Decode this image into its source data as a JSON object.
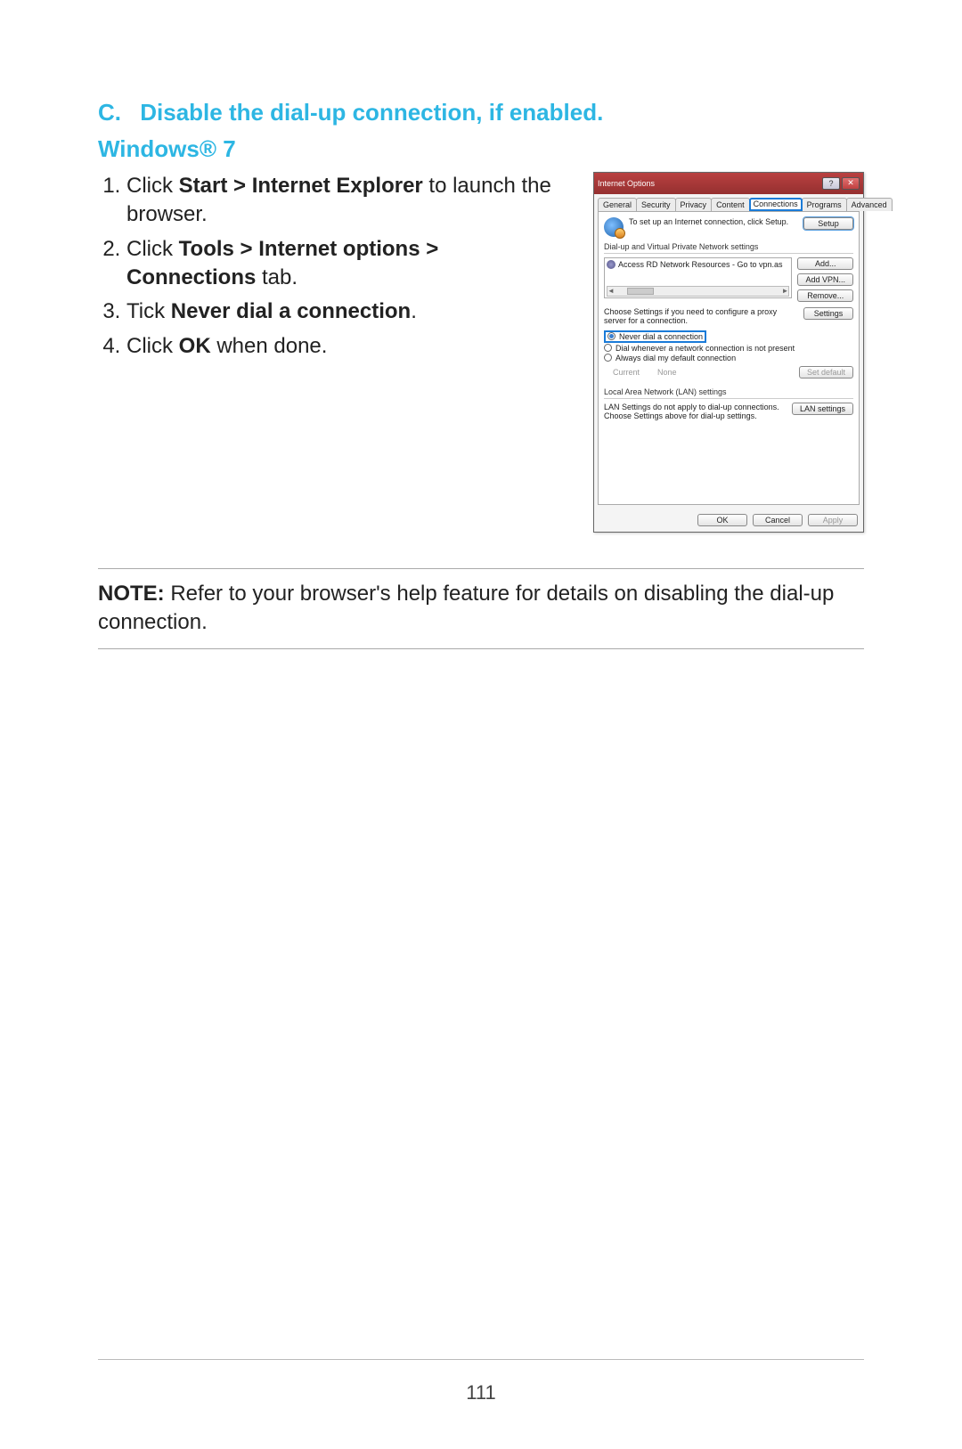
{
  "section": {
    "prefix": "C.",
    "title": "Disable the dial-up connection, if enabled.",
    "os": "Windows® 7"
  },
  "steps": {
    "s1a": "Click ",
    "s1b": "Start > Internet Explorer",
    "s1c": " to launch the browser.",
    "s2a": "Click ",
    "s2b": "Tools > Internet options > Connections",
    "s2c": " tab.",
    "s3a": "Tick ",
    "s3b": "Never dial a connection",
    "s3c": ".",
    "s4a": "Click ",
    "s4b": "OK",
    "s4c": " when done."
  },
  "note": {
    "label": "NOTE:",
    "text": " Refer to your browser's help feature for details on disabling the dial-up connection."
  },
  "dialog": {
    "title": "Internet Options",
    "tabs": {
      "general": "General",
      "security": "Security",
      "privacy": "Privacy",
      "content": "Content",
      "connections": "Connections",
      "programs": "Programs",
      "advanced": "Advanced"
    },
    "setup_text": "To set up an Internet connection, click Setup.",
    "setup_btn": "Setup",
    "dialup_group": "Dial-up and Virtual Private Network settings",
    "list_item": "Access RD Network Resources - Go to vpn.as",
    "add_btn": "Add...",
    "addvpn_btn": "Add VPN...",
    "remove_btn": "Remove...",
    "proxy_text": "Choose Settings if you need to configure a proxy server for a connection.",
    "settings_btn": "Settings",
    "radio_never": "Never dial a connection",
    "radio_whenever": "Dial whenever a network connection is not present",
    "radio_always": "Always dial my default connection",
    "current_label": "Current",
    "current_value": "None",
    "setdefault_btn": "Set default",
    "lan_group": "Local Area Network (LAN) settings",
    "lan_text": "LAN Settings do not apply to dial-up connections. Choose Settings above for dial-up settings.",
    "lan_btn": "LAN settings",
    "ok": "OK",
    "cancel": "Cancel",
    "apply": "Apply"
  },
  "page_number": "111"
}
